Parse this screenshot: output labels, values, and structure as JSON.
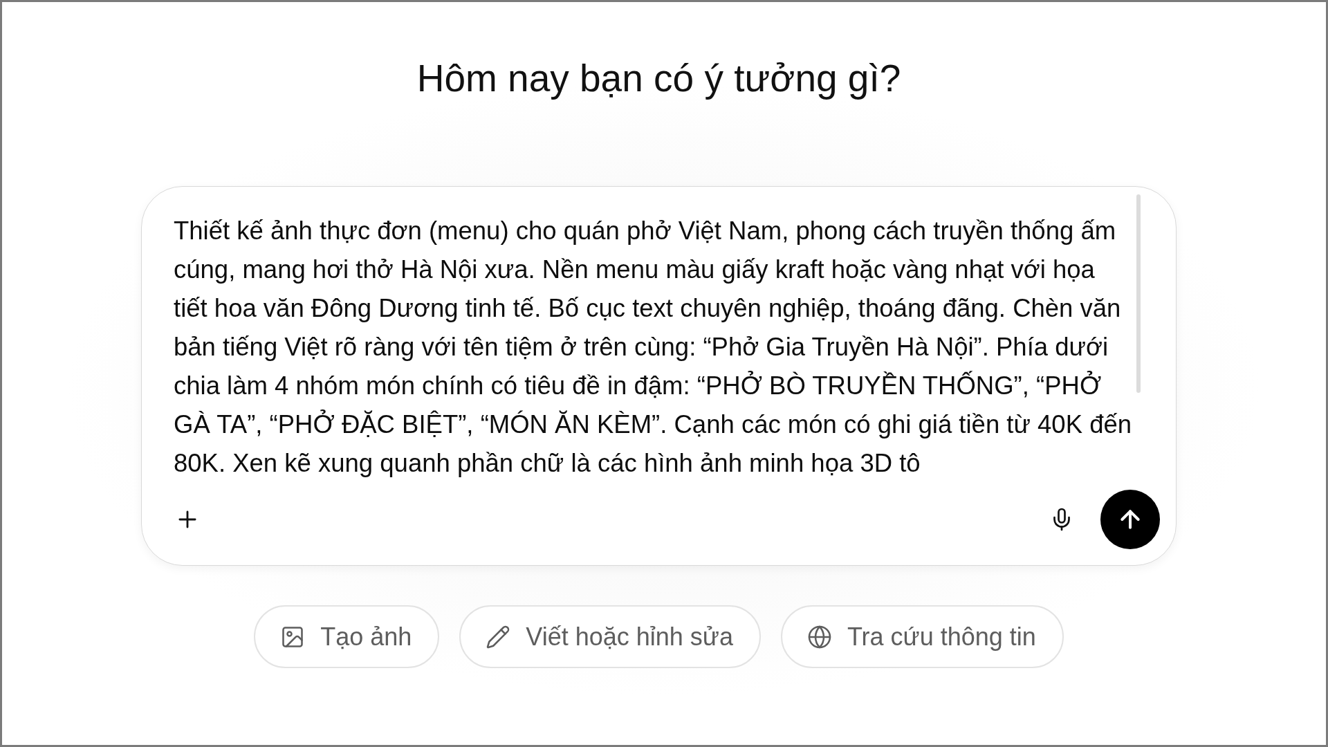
{
  "heading": "Hôm nay bạn có ý tưởng gì?",
  "composer": {
    "value": "Thiết kế ảnh thực đơn (menu) cho quán phở Việt Nam, phong cách truyền thống ấm cúng, mang hơi thở Hà Nội xưa. Nền menu màu giấy kraft hoặc vàng nhạt với họa tiết hoa văn Đông Dương tinh tế. Bố cục text chuyên nghiệp, thoáng đãng. Chèn văn bản tiếng Việt rõ ràng với tên tiệm ở trên cùng: “Phở Gia Truyền Hà Nội”. Phía dưới chia làm 4 nhóm món chính có tiêu đề in đậm: “PHỞ BÒ TRUYỀN THỐNG”, “PHỞ GÀ TA”, “PHỞ ĐẶC BIỆT”, “MÓN ĂN KÈM”. Cạnh các món có ghi giá tiền từ 40K đến 80K. Xen kẽ xung quanh phần chữ là các hình ảnh minh họa 3D tô"
  },
  "suggestions": [
    {
      "kind": "image",
      "label": "Tạo ảnh"
    },
    {
      "kind": "write",
      "label": "Viết hoặc hỉnh sửa"
    },
    {
      "kind": "research",
      "label": "Tra cứu thông tin"
    }
  ]
}
